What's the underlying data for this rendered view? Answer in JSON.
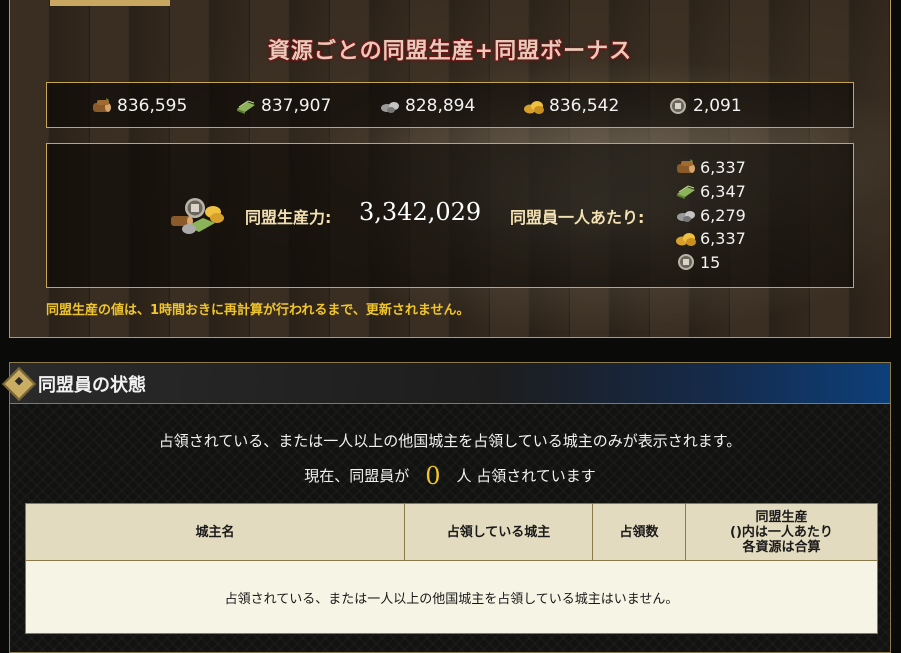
{
  "production_panel": {
    "title": "資源ごとの同盟生産+同盟ボーナス",
    "totals": [
      {
        "resource": "wood",
        "icon": "wood-icon",
        "value": "836,595"
      },
      {
        "resource": "cotton",
        "icon": "cotton-icon",
        "value": "837,907"
      },
      {
        "resource": "iron",
        "icon": "iron-icon",
        "value": "828,894"
      },
      {
        "resource": "food",
        "icon": "food-icon",
        "value": "836,542"
      },
      {
        "resource": "coin",
        "icon": "coin-icon",
        "value": "2,091"
      }
    ],
    "production_label": "同盟生産力:",
    "production_total": "3,342,029",
    "per_member_label": "同盟員一人あたり:",
    "per_member": [
      {
        "resource": "wood",
        "icon": "wood-icon",
        "value": "6,337"
      },
      {
        "resource": "cotton",
        "icon": "cotton-icon",
        "value": "6,347"
      },
      {
        "resource": "iron",
        "icon": "iron-icon",
        "value": "6,279"
      },
      {
        "resource": "food",
        "icon": "food-icon",
        "value": "6,337"
      },
      {
        "resource": "coin",
        "icon": "coin-icon",
        "value": "15"
      }
    ],
    "notice": "同盟生産の値は、1時間おきに再計算が行われるまで、更新されません。"
  },
  "member_status": {
    "title": "同盟員の状態",
    "description": "占領されている、または一人以上の他国城主を占領している城主のみが表示されます。",
    "occupied_prefix": "現在、同盟員が",
    "occupied_count": "0",
    "occupied_suffix": "人 占領されています",
    "table": {
      "headers": {
        "lord_name": "城主名",
        "occupying_lord": "占領している城主",
        "occupied_count": "占領数",
        "production_line1": "同盟生産",
        "production_line2": "()内は一人あたり",
        "production_line3": "各資源は合算"
      },
      "empty_message": "占領されている、または一人以上の他国城主を占領している城主はいません。"
    }
  },
  "colors": {
    "accent_gold": "#c5a655",
    "notice_yellow": "#f0c52a",
    "header_blue": "#0d3f7a",
    "table_header_bg": "#e3dbbf",
    "table_body_bg": "#f6f4e4"
  }
}
